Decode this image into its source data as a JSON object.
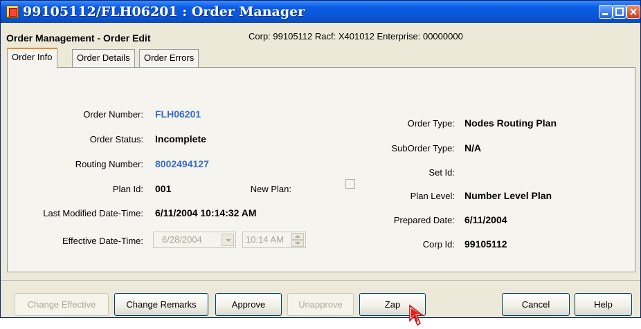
{
  "window": {
    "title": "99105112/FLH06201 : Order Manager"
  },
  "header": {
    "title": "Order Management - Order Edit",
    "info": "Corp: 99105112  Racf:  X401012   Enterprise: 00000000"
  },
  "tabs": [
    {
      "label": "Order Info",
      "active": true
    },
    {
      "label": "Order Details",
      "active": false
    },
    {
      "label": "Order Errors",
      "active": false
    }
  ],
  "left_fields": {
    "order_number": {
      "label": "Order Number:",
      "value": "FLH06201"
    },
    "order_status": {
      "label": "Order Status:",
      "value": "Incomplete"
    },
    "routing_number": {
      "label": "Routing Number:",
      "value": "8002494127"
    },
    "plan_id": {
      "label": "Plan Id:",
      "value": "001"
    },
    "new_plan": {
      "label": "New Plan:",
      "checked": false
    },
    "last_modified": {
      "label": "Last Modified Date-Time:",
      "value": "6/11/2004 10:14:32 AM"
    },
    "effective": {
      "label": "Effective Date-Time:",
      "date": "6/28/2004",
      "time": "10:14 AM"
    }
  },
  "right_fields": {
    "order_type": {
      "label": "Order Type:",
      "value": "Nodes Routing Plan"
    },
    "suborder_type": {
      "label": "SubOrder Type:",
      "value": "N/A"
    },
    "set_id": {
      "label": "Set Id:",
      "value": ""
    },
    "plan_level": {
      "label": "Plan Level:",
      "value": "Number Level Plan"
    },
    "prepared_date": {
      "label": "Prepared Date:",
      "value": "6/11/2004"
    },
    "corp_id": {
      "label": "Corp Id:",
      "value": "99105112"
    }
  },
  "buttons": {
    "change_effective": {
      "label": "Change Effective",
      "enabled": false
    },
    "change_remarks": {
      "label": "Change Remarks",
      "enabled": true
    },
    "approve": {
      "label": "Approve",
      "enabled": true
    },
    "unapprove": {
      "label": "Unapprove",
      "enabled": false
    },
    "zap": {
      "label": "Zap",
      "enabled": true
    },
    "cancel": {
      "label": "Cancel",
      "enabled": true
    },
    "help": {
      "label": "Help",
      "enabled": true
    }
  },
  "colors": {
    "titlebar": "#0b56d6",
    "link_value": "#3a6bc8",
    "disabled_text": "#aca899",
    "tab_highlight": "#e68b2c"
  },
  "icons": [
    "app-icon",
    "minimize-icon",
    "maximize-icon",
    "close-icon",
    "mouse-cursor-icon"
  ]
}
